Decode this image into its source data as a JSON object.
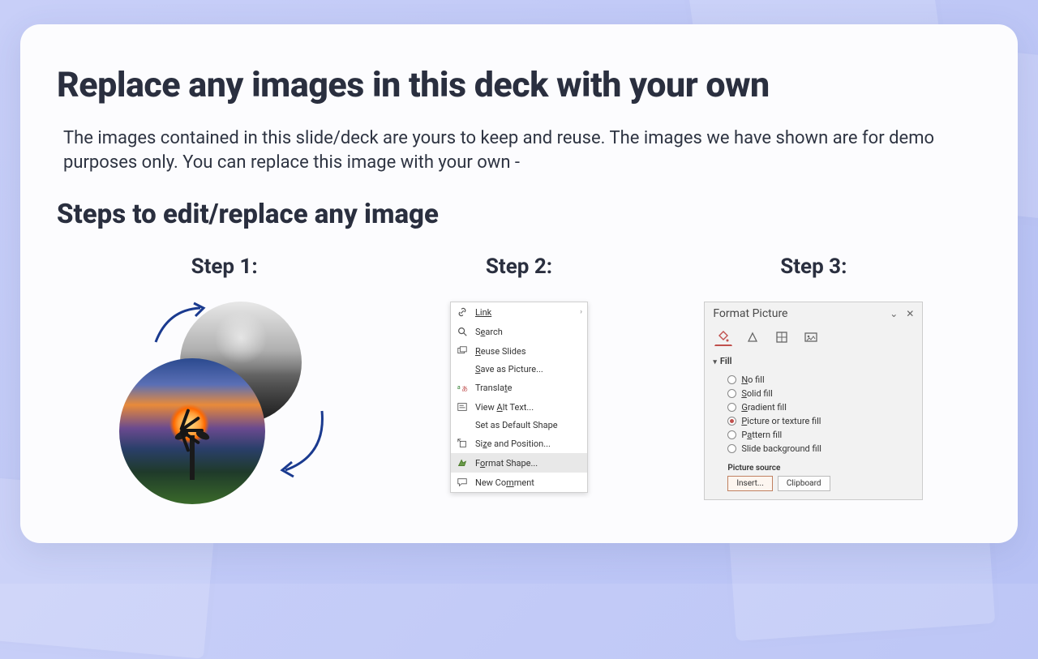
{
  "title": "Replace any images in this deck with your own",
  "description": "The images contained in this slide/deck are yours to keep and reuse. The images we have shown are for demo purposes only. You can replace this image with your own -",
  "subtitle": "Steps to edit/replace any image",
  "steps": {
    "s1": {
      "label": "Step 1:"
    },
    "s2": {
      "label": "Step 2:"
    },
    "s3": {
      "label": "Step 3:"
    }
  },
  "context_menu": {
    "link": "Link",
    "search": "Search",
    "reuse_slides": "Reuse Slides",
    "save_as_picture": "Save as Picture...",
    "translate": "Translate",
    "view_alt_text": "View Alt Text...",
    "set_default_shape": "Set as Default Shape",
    "size_position": "Size and Position...",
    "format_shape": "Format Shape...",
    "new_comment": "New Comment"
  },
  "format_panel": {
    "title": "Format Picture",
    "section": "Fill",
    "options": {
      "no_fill": "No fill",
      "solid_fill": "Solid fill",
      "gradient_fill": "Gradient fill",
      "picture_texture_fill": "Picture or texture fill",
      "pattern_fill": "Pattern fill",
      "slide_bg_fill": "Slide background fill"
    },
    "picture_source": "Picture source",
    "buttons": {
      "insert": "Insert...",
      "clipboard": "Clipboard"
    }
  }
}
